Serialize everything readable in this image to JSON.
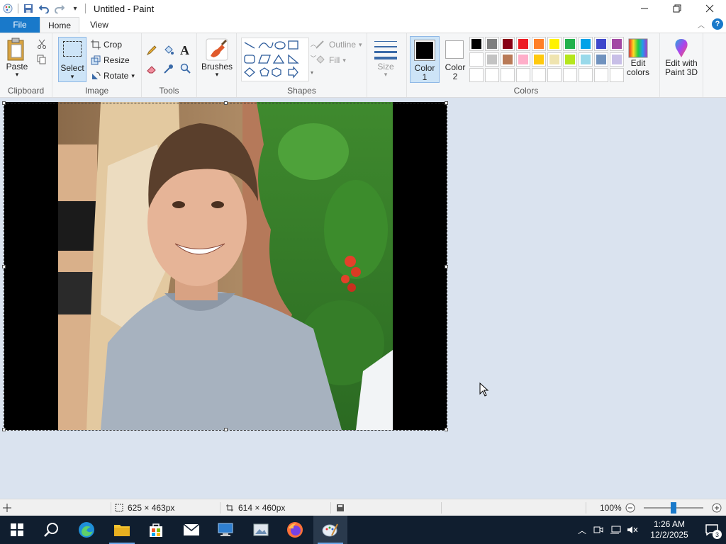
{
  "window": {
    "title": "Untitled - Paint",
    "controls": [
      "minimize",
      "restore",
      "close"
    ]
  },
  "tabs": {
    "file": "File",
    "home": "Home",
    "view": "View"
  },
  "ribbon": {
    "clipboard": {
      "paste": "Paste",
      "label": "Clipboard"
    },
    "image": {
      "select": "Select",
      "crop": "Crop",
      "resize": "Resize",
      "rotate": "Rotate",
      "label": "Image"
    },
    "tools": {
      "label": "Tools"
    },
    "brushes": {
      "label": "Brushes"
    },
    "shapes": {
      "outline": "Outline",
      "fill": "Fill",
      "label": "Shapes"
    },
    "size": {
      "label": "Size"
    },
    "color1": {
      "label_line1": "Color",
      "label_line2": "1",
      "color": "#000000"
    },
    "color2": {
      "label_line1": "Color",
      "label_line2": "2",
      "color": "#ffffff"
    },
    "colors": {
      "label": "Colors",
      "row1": [
        "#000000",
        "#7f7f7f",
        "#880015",
        "#ed1c24",
        "#ff7f27",
        "#fff200",
        "#22b14c",
        "#00a2e8",
        "#3f48cc",
        "#a349a4"
      ],
      "row2": [
        "#ffffff",
        "#c3c3c3",
        "#b97a57",
        "#ffaec9",
        "#ffc90e",
        "#efe4b0",
        "#b5e61d",
        "#99d9ea",
        "#7092be",
        "#c8bfe7"
      ],
      "row3": [
        "",
        "",
        "",
        "",
        "",
        "",
        "",
        "",
        "",
        ""
      ]
    },
    "edit_colors": {
      "line1": "Edit",
      "line2": "colors"
    },
    "paint3d": {
      "line1": "Edit with",
      "line2": "Paint 3D"
    }
  },
  "status": {
    "selection_size": "625 × 463px",
    "image_size": "614 × 460px",
    "zoom": "100%"
  },
  "taskbar": {
    "apps": [
      "start",
      "search",
      "edge",
      "file-explorer",
      "store",
      "mail",
      "remote-desktop",
      "paint-ish",
      "firefox",
      "paint"
    ],
    "clock_time": "1:26 AM",
    "clock_date": "12/2/2025",
    "notifications": "3"
  }
}
